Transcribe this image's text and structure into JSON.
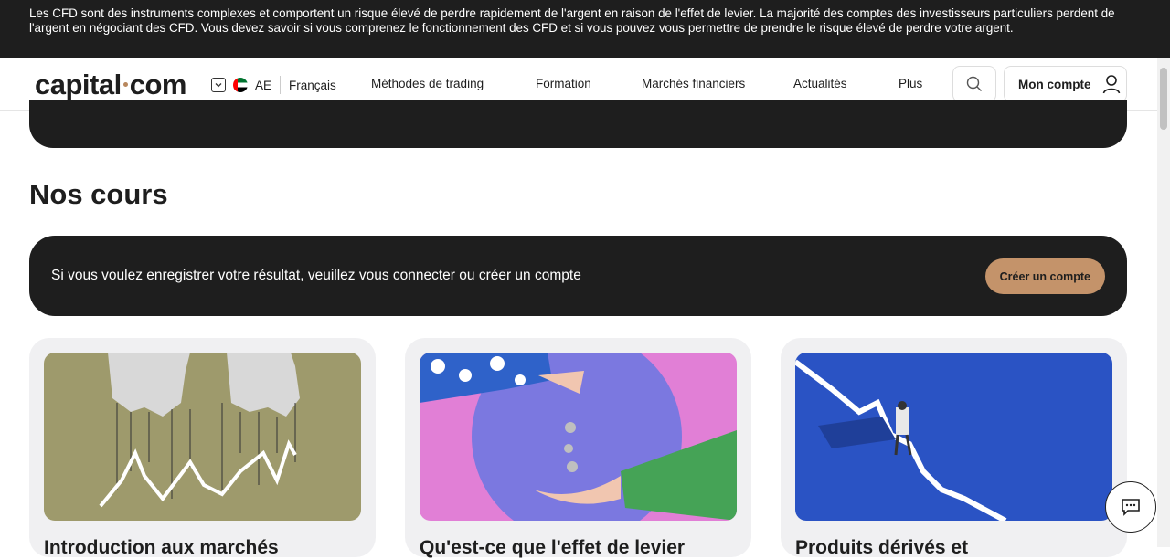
{
  "risk_warning": "Les CFD sont des instruments complexes et comportent un risque élevé de perdre rapidement de l'argent en raison de l'effet de levier. La majorité des comptes des investisseurs particuliers perdent de l'argent en négociant des CFD. Vous devez savoir si vous comprenez le fonctionnement des CFD et si vous pouvez vous permettre de prendre le risque élevé de perdre votre argent.",
  "header": {
    "logo_left": "capital",
    "logo_right": "com",
    "region_code": "AE",
    "language": "Français",
    "nav": [
      "Méthodes de trading",
      "Formation",
      "Marchés financiers",
      "Actualités",
      "Plus"
    ],
    "account_label": "Mon compte"
  },
  "main": {
    "section_title": "Nos cours",
    "login_prompt": "Si vous voulez enregistrer votre résultat, veuillez vous connecter ou créer un compte",
    "create_account_label": "Créer un compte",
    "courses": [
      {
        "title": "Introduction aux marchés"
      },
      {
        "title": "Qu'est-ce que l'effet de levier"
      },
      {
        "title": "Produits dérivés et"
      }
    ]
  },
  "colors": {
    "dark": "#1e1e1e",
    "accent": "#c4936a",
    "card_bg": "#f0f0f2"
  },
  "icons": [
    "chevron-down-icon",
    "uae-flag-icon",
    "search-icon",
    "user-icon",
    "chat-icon"
  ]
}
